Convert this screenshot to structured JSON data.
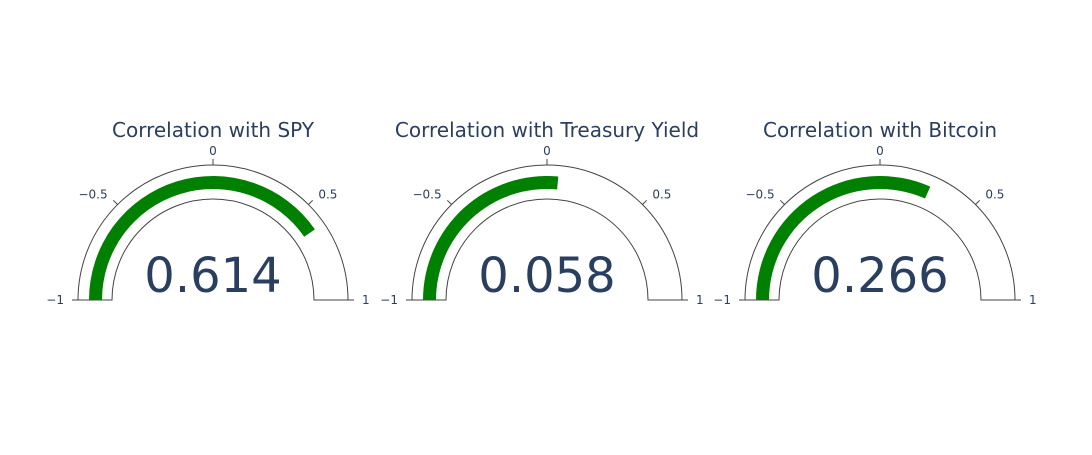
{
  "chart_data": {
    "type": "gauge",
    "range": [
      -1,
      1
    ],
    "ticks": [
      -1,
      -0.5,
      0,
      0.5,
      1
    ],
    "tick_labels": [
      "−1",
      "−0.5",
      "0",
      "0.5",
      "1"
    ],
    "bar_color": "#008000",
    "outline_color": "#444444",
    "text_color": "#2a3f5f",
    "gauges": [
      {
        "title": "Correlation with SPY",
        "value": 0.614,
        "value_label": "0.614"
      },
      {
        "title": "Correlation with Treasury Yield",
        "value": 0.058,
        "value_label": "0.058"
      },
      {
        "title": "Correlation with Bitcoin",
        "value": 0.266,
        "value_label": "0.266"
      }
    ]
  }
}
